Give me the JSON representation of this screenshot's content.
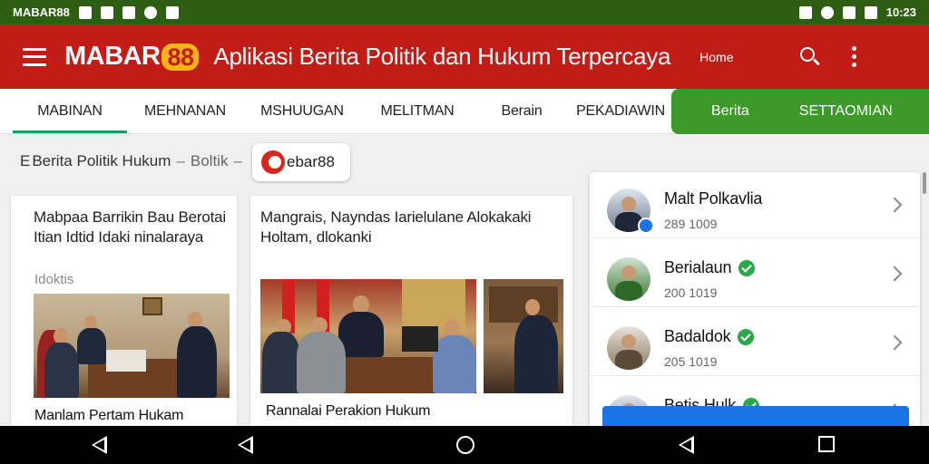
{
  "status_bar": {
    "carrier": "MABAR88",
    "time": "10:23"
  },
  "app_bar": {
    "logo_text": "MABAR",
    "logo_number": "88",
    "title": "Aplikasi Berita Politik dan Hukum Terpercaya",
    "home_label": "Home"
  },
  "tabs": [
    {
      "label": "MABINAN"
    },
    {
      "label": "MEHNANAN"
    },
    {
      "label": "MSHUUGAN"
    },
    {
      "label": "MELITMAN"
    },
    {
      "label": "Berain"
    },
    {
      "label": "PEKADIAWIN"
    }
  ],
  "green_tabs": [
    {
      "label": "Berita"
    },
    {
      "label": "SETTAOMIAN"
    }
  ],
  "breadcrumb": {
    "prefix": "E",
    "section": "Berita Politik Hukum",
    "sub": "Boltik"
  },
  "chip": {
    "label": "ebar88"
  },
  "articles": [
    {
      "title": "Mabpaa Barrikin Bau Berotai Itian Idtid Idaki ninalaraya",
      "meta": "Idoktis",
      "caption": "Manlam Pertam Hukam"
    },
    {
      "title": "Mangrais, Nayndas Iarielulane Alokakaki Holtam, dlokanki",
      "caption": "Rannalai Perakion Hukum"
    }
  ],
  "right_list": [
    {
      "name": "Malt Polkavlia",
      "sub": "289 1009",
      "verified": false
    },
    {
      "name": "Berialaun",
      "sub": "200 1019",
      "verified": true
    },
    {
      "name": "Badaldok",
      "sub": "205 1019",
      "verified": true
    },
    {
      "name": "Betis Hulk",
      "sub": "",
      "verified": true
    }
  ],
  "colors": {
    "status_bar": "#2e5e12",
    "app_bar": "#c21c17",
    "logo_badge": "#f7b21c",
    "active_tab_underline": "#1a9e6a",
    "green_tab": "#3d9a2a",
    "verified": "#2aa84a",
    "link_blue": "#1b73e8"
  },
  "icons": {
    "menu": "hamburger-icon",
    "search": "search-icon",
    "more": "kebab-icon",
    "back": "back-icon",
    "home": "home-icon",
    "recents": "recents-icon"
  }
}
